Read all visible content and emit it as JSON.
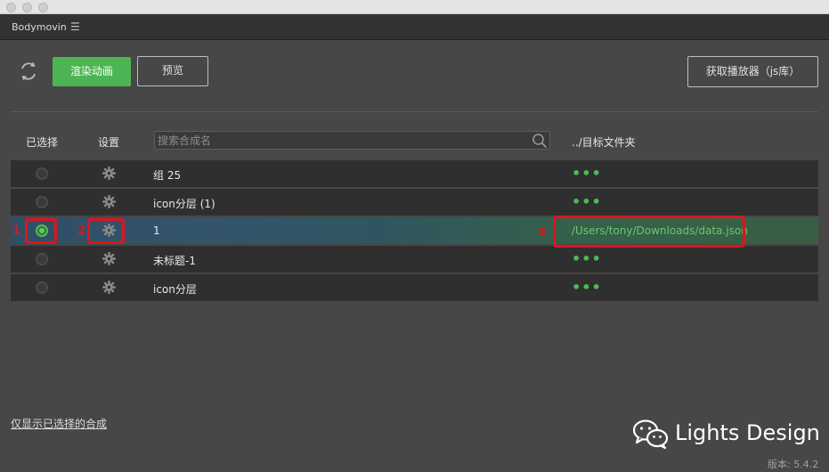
{
  "window": {
    "panel_title": "Bodymovin"
  },
  "toolbar": {
    "render_label": "渲染动画",
    "preview_label": "预览",
    "player_label": "获取播放器（js库）"
  },
  "table": {
    "headers": {
      "selected": "已选择",
      "settings": "设置",
      "destination": "../目标文件夹"
    },
    "search_placeholder": "搜索合成名",
    "rows": [
      {
        "name": "组 25",
        "selected": false,
        "destination": "•••"
      },
      {
        "name": "icon分层 (1)",
        "selected": false,
        "destination": "•••"
      },
      {
        "name": "1",
        "selected": true,
        "destination": "/Users/tony/Downloads/data.json"
      },
      {
        "name": "未标题-1",
        "selected": false,
        "destination": "•••"
      },
      {
        "name": "icon分层",
        "selected": false,
        "destination": "•••"
      }
    ]
  },
  "annotations": [
    "1",
    "2",
    "3"
  ],
  "footer": {
    "filter_link": "仅显示已选择的合成",
    "version": "版本: 5.4.2"
  },
  "watermark": {
    "text": "Lights Design"
  },
  "colors": {
    "accent": "#4cb452",
    "highlight": "#e0141c",
    "path_text": "#69c96e"
  }
}
